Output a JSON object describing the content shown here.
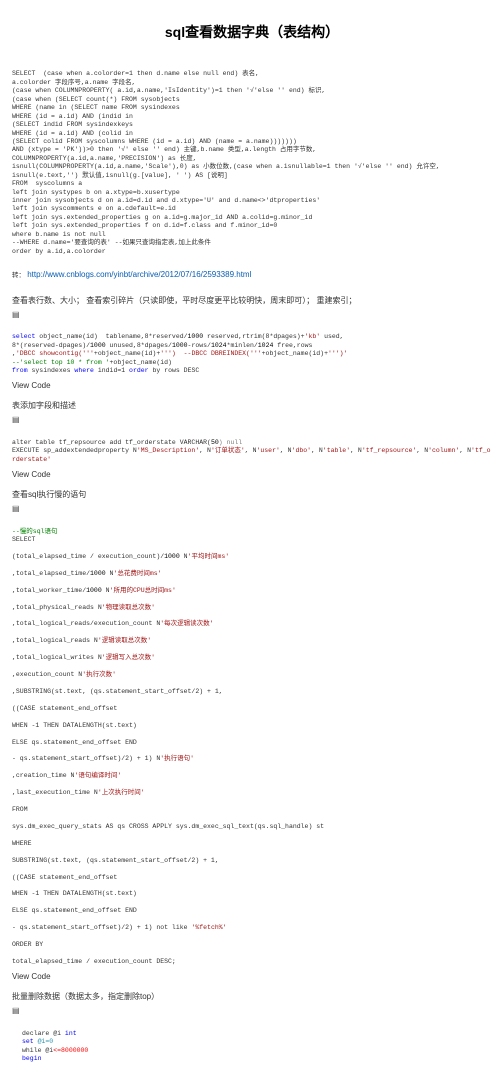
{
  "title": "sql查看数据字典（表结构）",
  "block1": {
    "l1": "SELECT  (case when a.colorder=1 then d.name else null end) 表名,",
    "l2": "a.colorder 字段序号,a.name 字段名,",
    "l3": "(case when COLUMNPROPERTY( a.id,a.name,'IsIdentity')=1 then '√'else '' end) 标识,",
    "l4": "(case when (SELECT count(*) FROM sysobjects",
    "l5": "WHERE (name in (SELECT name FROM sysindexes",
    "l6": "WHERE (id = a.id) AND (indid in",
    "l7": "(SELECT indid FROM sysindexkeys",
    "l8": "WHERE (id = a.id) AND (colid in",
    "l9": "(SELECT colid FROM syscolumns WHERE (id = a.id) AND (name = a.name)))))))",
    "l10": "AND (xtype = 'PK'))>0 then '√' else '' end) 主键,b.name 类型,a.length 占用字节数,",
    "l11": "COLUMNPROPERTY(a.id,a.name,'PRECISION') as 长度,",
    "l12": "isnull(COLUMNPROPERTY(a.id,a.name,'Scale'),0) as 小数位数,(case when a.isnullable=1 then '√'else '' end) 允许空,",
    "l13": "isnull(e.text,'') 默认值,isnull(g.[value], ' ') AS [说明]",
    "l14": "FROM  syscolumns a",
    "l15": "left join systypes b on a.xtype=b.xusertype",
    "l16": "inner join sysobjects d on a.id=d.id and d.xtype='U' and d.name<>'dtproperties'",
    "l17": "left join syscomments e on a.cdefault=e.id",
    "l18": "left join sys.extended_properties g on a.id=g.major_id AND a.colid=g.minor_id",
    "l19": "left join sys.extended_properties f on d.id=f.class and f.minor_id=0",
    "l20": "where b.name is not null",
    "l21": "--WHERE d.name='要查询的表' --如果只查询指定表,加上此条件",
    "l22": "order by a.id,a.colorder"
  },
  "ref": {
    "prefix": "转：",
    "url": "http://www.cnblogs.com/yinbt/archive/2012/07/16/2593389.html"
  },
  "section2": {
    "title": "查看表行数、大小；   查看索引碎片（只读即使，平时尽度更平比较明快，周末即可）；   重建索引；",
    "brace": "▤"
  },
  "block2": {
    "l1a": "select",
    "l1b": " object_name(id)  tablename,8*reserved/",
    "l1c": "1000",
    "l1d": " reserved,rtrim(8*dpages)+",
    "l1e": "'kb'",
    "l1f": " used,",
    "l2a": "8*(reserved-dpages)/",
    "l2b": "1000",
    "l2c": " unused,8*dpages/",
    "l2d": "1000",
    "l2e": "-rows/",
    "l2f": "1024",
    "l2g": "*minlen/",
    "l2h": "1024",
    "l2i": " free,rows",
    "l3a": ",",
    "l3b": "'DBCC showcontig('''",
    "l3c": "+object_name(id)+",
    "l3d": "''')  --DBCC DBREINDEX('''",
    "l3e": "+object_name(id)+",
    "l3f": "''')'",
    "l4a": "--'select top 10 * from '",
    "l4b": "+object_name(id)",
    "l5a": "from",
    "l5b": " sysindexes ",
    "l5c": "where",
    "l5d": " indid=1 ",
    "l5e": "order",
    "l5f": " by rows DESC"
  },
  "vc1": "View Code",
  "section3": {
    "title": "表添加字段和描述",
    "brace": "▤"
  },
  "block3": {
    "l1a": "alter table tf_repsource add tf_orderstate VARCHAR(",
    "l1b": "50",
    "l1c": ") null",
    "l2a": "EXECUTE sp_addextendedproperty N",
    "l2b": "'MS_Description'",
    "l2c": ", N",
    "l2d": "'订单状态'",
    "l2e": ", N",
    "l2f": "'user'",
    "l2g": ", N",
    "l2h": "'dbo'",
    "l2i": ", N",
    "l2j": "'table'",
    "l2k": ", N",
    "l2l": "'tf_repsource'",
    "l2m": ", N",
    "l2n": "'column'",
    "l2o": ", N",
    "l2p": "'tf_orderstate'"
  },
  "vc2": "View Code",
  "section4": {
    "title": "查看sql执行慢的语句",
    "brace": "▤"
  },
  "block4": {
    "l1": "--慢的sql语句",
    "l2": "SELECT",
    "l3a": "(total_elapsed_time / execution_count)/",
    "l3b": "1000",
    "l3c": " N",
    "l3d": "'平均时间ms'",
    "l4a": ",total_elapsed_time/",
    "l4b": "1000",
    "l4c": " N",
    "l4d": "'总花费时间ms'",
    "l5a": ",total_worker_time/",
    "l5b": "1000",
    "l5c": " N",
    "l5d": "'所用的CPU总时间ms'",
    "l6a": ",total_physical_reads N",
    "l6b": "'物理读取总次数'",
    "l7a": ",total_logical_reads/execution_count N",
    "l7b": "'每次逻辑读次数'",
    "l8a": ",total_logical_reads N",
    "l8b": "'逻辑读取总次数'",
    "l9a": ",total_logical_writes N",
    "l9b": "'逻辑写入总次数'",
    "l10a": ",execution_count N",
    "l10b": "'执行次数'",
    "l11": ",SUBSTRING(st.text, (qs.statement_start_offset/2) + 1,",
    "l12": "((CASE statement_end_offset",
    "l13": "WHEN -1 THEN DATALENGTH(st.text)",
    "l14": "ELSE qs.statement_end_offset END",
    "l15a": "- qs.statement_start_offset)/2) + 1) N",
    "l15b": "'执行语句'",
    "l16a": ",creation_time N",
    "l16b": "'语句编译时间'",
    "l17a": ",last_execution_time N",
    "l17b": "'上次执行时间'",
    "l18": "FROM",
    "l19": "sys.dm_exec_query_stats AS qs CROSS APPLY sys.dm_exec_sql_text(qs.sql_handle) st",
    "l20": "WHERE",
    "l21": "SUBSTRING(st.text, (qs.statement_start_offset/2) + 1,",
    "l22": "((CASE statement_end_offset",
    "l23": "WHEN -1 THEN DATALENGTH(st.text)",
    "l24": "ELSE qs.statement_end_offset END",
    "l25a": "- qs.statement_start_offset)/2) + 1) not like ",
    "l25b": "'%fetch%'",
    "l26": "ORDER BY",
    "l27": "total_elapsed_time / execution_count DESC;"
  },
  "vc3": "View Code",
  "section5": {
    "title": "批量删除数据（数据太多，指定删除top）",
    "brace": "▤"
  },
  "block5": {
    "l1a": "declare @i ",
    "l1b": "int",
    "l2a": "set ",
    "l2b": "@i=0",
    "l3a": "while @i",
    "l3b": "<=8000000",
    "l4": "begin"
  }
}
